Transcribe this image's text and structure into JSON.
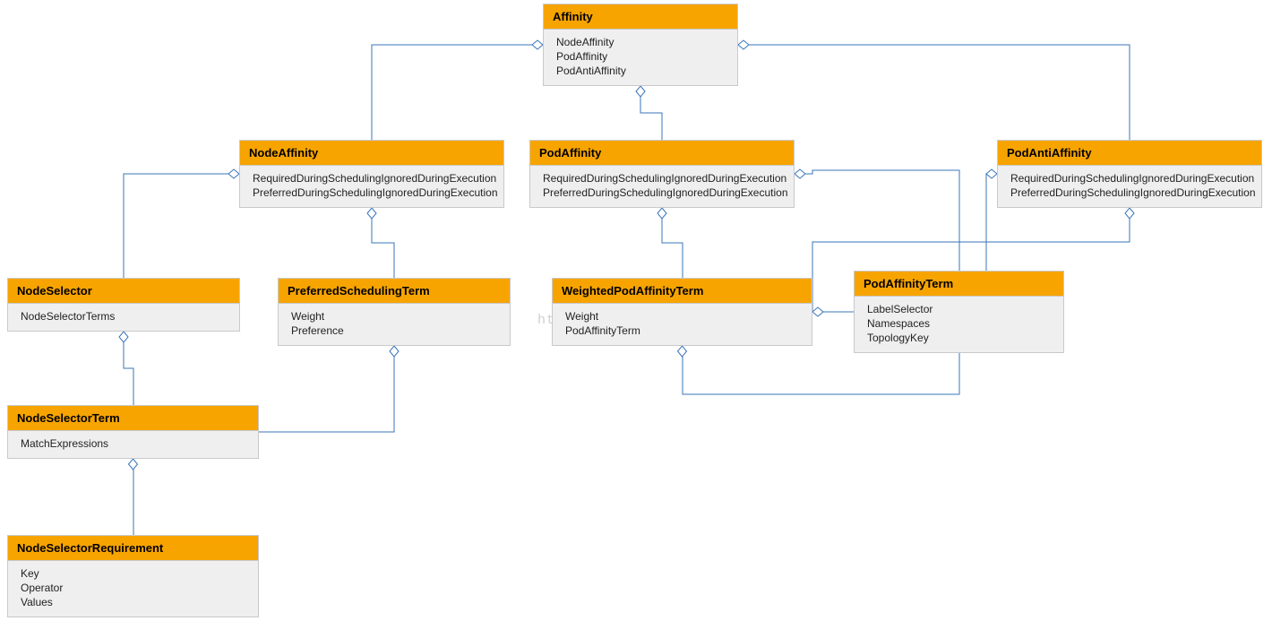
{
  "watermark": "http://blog.csdn.net/horsefoot",
  "boxes": {
    "affinity": {
      "title": "Affinity",
      "attrs": [
        "NodeAffinity",
        "PodAffinity",
        "PodAntiAffinity"
      ]
    },
    "nodeAffinity": {
      "title": "NodeAffinity",
      "attrs": [
        "RequiredDuringSchedulingIgnoredDuringExecution",
        "PreferredDuringSchedulingIgnoredDuringExecution"
      ]
    },
    "podAffinity": {
      "title": "PodAffinity",
      "attrs": [
        "RequiredDuringSchedulingIgnoredDuringExecution",
        "PreferredDuringSchedulingIgnoredDuringExecution"
      ]
    },
    "podAntiAffinity": {
      "title": "PodAntiAffinity",
      "attrs": [
        "RequiredDuringSchedulingIgnoredDuringExecution",
        "PreferredDuringSchedulingIgnoredDuringExecution"
      ]
    },
    "nodeSelector": {
      "title": "NodeSelector",
      "attrs": [
        "NodeSelectorTerms"
      ]
    },
    "preferredSchedulingTerm": {
      "title": "PreferredSchedulingTerm",
      "attrs": [
        "Weight",
        "Preference"
      ]
    },
    "weightedPodAffinityTerm": {
      "title": "WeightedPodAffinityTerm",
      "attrs": [
        "Weight",
        "PodAffinityTerm"
      ]
    },
    "podAffinityTerm": {
      "title": "PodAffinityTerm",
      "attrs": [
        "LabelSelector",
        "Namespaces",
        "TopologyKey"
      ]
    },
    "nodeSelectorTerm": {
      "title": "NodeSelectorTerm",
      "attrs": [
        "MatchExpressions"
      ]
    },
    "nodeSelectorRequirement": {
      "title": "NodeSelectorRequirement",
      "attrs": [
        "Key",
        "Operator",
        "Values"
      ]
    }
  },
  "connectors": [
    {
      "from": "affinity",
      "fromSide": "left",
      "to": "nodeAffinity",
      "toSide": "top",
      "diamondAt": "from"
    },
    {
      "from": "affinity",
      "fromSide": "bottom",
      "to": "podAffinity",
      "toSide": "top",
      "diamondAt": "from"
    },
    {
      "from": "affinity",
      "fromSide": "right",
      "to": "podAntiAffinity",
      "toSide": "top",
      "diamondAt": "from"
    },
    {
      "from": "nodeAffinity",
      "fromSide": "left",
      "to": "nodeSelector",
      "toSide": "top",
      "diamondAt": "from"
    },
    {
      "from": "nodeAffinity",
      "fromSide": "bottom",
      "to": "preferredSchedulingTerm",
      "toSide": "top",
      "diamondAt": "from"
    },
    {
      "from": "podAffinity",
      "fromSide": "bottom",
      "to": "weightedPodAffinityTerm",
      "toSide": "top",
      "diamondAt": "from"
    },
    {
      "from": "podAffinity",
      "fromSide": "right",
      "to": "podAffinityTerm",
      "toSide": "top",
      "diamondAt": "from",
      "joinY": 190
    },
    {
      "from": "podAntiAffinity",
      "fromSide": "left",
      "to": "podAffinityTerm",
      "toSide": "top",
      "diamondAt": "from",
      "joinY": 280,
      "offsetToX": 30
    },
    {
      "from": "podAntiAffinity",
      "fromSide": "bottom",
      "to": "weightedPodAffinityTerm",
      "toSide": "right",
      "diamondAt": "from",
      "joinY": 270
    },
    {
      "from": "weightedPodAffinityTerm",
      "fromSide": "right",
      "to": "podAffinityTerm",
      "toSide": "left",
      "diamondAt": "from"
    },
    {
      "from": "weightedPodAffinityTerm",
      "fromSide": "bottom",
      "to": "podAffinityTerm",
      "toSide": "bottom",
      "diamondAt": "from",
      "joinY": 440
    },
    {
      "from": "nodeSelector",
      "fromSide": "bottom",
      "to": "nodeSelectorTerm",
      "toSide": "top",
      "diamondAt": "from"
    },
    {
      "from": "preferredSchedulingTerm",
      "fromSide": "bottom",
      "to": "nodeSelectorTerm",
      "toSide": "right",
      "diamondAt": "from"
    },
    {
      "from": "nodeSelectorTerm",
      "fromSide": "bottom",
      "to": "nodeSelectorRequirement",
      "toSide": "top",
      "diamondAt": "from"
    }
  ]
}
